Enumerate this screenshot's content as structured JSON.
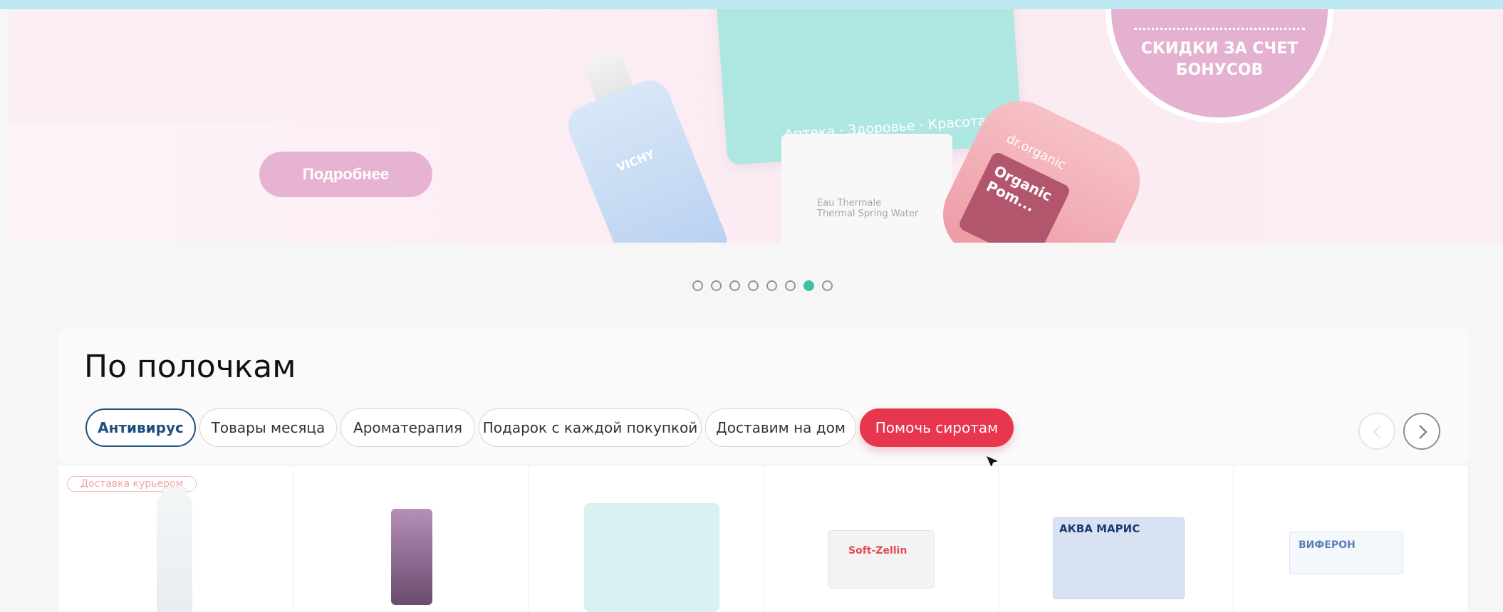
{
  "banner": {
    "more_label": "Подробнее",
    "card_text": "Аптека · Здоровье · Красота",
    "badge_text_line1": "СКИДКИ ЗА СЧЕТ",
    "badge_text_line2": "БОНУСОВ",
    "vichy_label": "VICHY",
    "avene_text_line1": "Eau Thermale",
    "avene_text_line2": "Thermal Spring Water",
    "pink_brand": "dr.organic",
    "pink_label": "Organic Pom..."
  },
  "slider": {
    "dots": [
      false,
      false,
      false,
      false,
      false,
      false,
      true,
      false
    ]
  },
  "shelf": {
    "title": "По полочкам",
    "tabs": [
      {
        "label": "Антивирус",
        "active": true
      },
      {
        "label": "Товары месяца",
        "active": false
      },
      {
        "label": "Ароматерапия",
        "active": false
      },
      {
        "label": "Подарок с каждой покупкой",
        "active": false
      },
      {
        "label": "Доставим на дом",
        "active": false
      },
      {
        "label": "Помочь сиротам",
        "active": false
      }
    ]
  },
  "products": {
    "delivery_badge": "Доставка курьером",
    "p4_label": "Soft-Zellin",
    "p5_label": "АКВА МАРИС",
    "p6_label": "ВИФЕРОН"
  },
  "colors": {
    "accent_teal": "#3bc3a2",
    "accent_red": "#e7364e",
    "active_tab": "#1f4f7d",
    "banner_pink": "#e7b3d3"
  }
}
